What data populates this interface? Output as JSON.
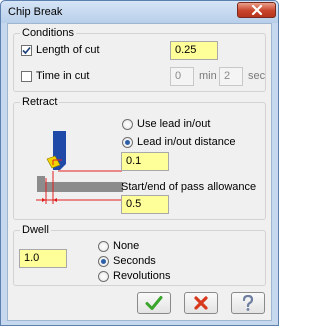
{
  "window": {
    "title": "Chip Break"
  },
  "conditions": {
    "group_label": "Conditions",
    "length_of_cut": {
      "label": "Length of cut",
      "checked": true,
      "value": "0.25"
    },
    "time_in_cut": {
      "label": "Time in cut",
      "checked": false,
      "min_value": "0",
      "min_unit": "min",
      "sec_value": "2",
      "sec_unit": "sec"
    }
  },
  "retract": {
    "group_label": "Retract",
    "use_lead_label": "Use lead in/out",
    "lead_distance_label": "Lead in/out distance",
    "selected": "lead_distance",
    "lead_distance_value": "0.1",
    "allowance_label": "Start/end of pass allowance",
    "allowance_value": "0.5"
  },
  "dwell": {
    "group_label": "Dwell",
    "value": "1.0",
    "options": [
      "None",
      "Seconds",
      "Revolutions"
    ],
    "selected": "Seconds"
  },
  "colors": {
    "field": "#ffff99",
    "ok": "#3aa52b",
    "cancel": "#d8391c",
    "accent": "#2d5fa8"
  }
}
